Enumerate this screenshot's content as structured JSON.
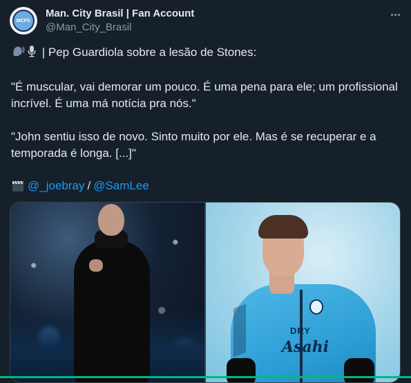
{
  "author": {
    "display_name": "Man. City Brasil | Fan Account",
    "handle": "@Man_City_Brasil",
    "avatar_icon": "man-city-crest-icon",
    "avatar_text": "MCFC"
  },
  "tweet": {
    "line1": "| Pep Guardiola sobre a lesão de Stones:",
    "line1_icons": [
      "speaking-head-icon",
      "microphone-icon"
    ],
    "quote1": "\"É muscular, vai demorar um pouco. É uma pena para ele; um profissional incrível. É uma má notícia pra nós.\"",
    "quote2": "\"John sentiu isso de novo. Sinto muito por ele. Mas é se recuperar e a temporada é longa. [...]\"",
    "credits_icon": "clapper-board-icon",
    "mention1": "@_joebray",
    "separator": "/",
    "mention2": "@SamLee"
  },
  "media": {
    "photo_sponsor_text": "Asahi",
    "photo_shirt_text": "DRY"
  },
  "colors": {
    "background": "#15202b",
    "text": "#e7e9ea",
    "secondary": "#8b98a5",
    "link": "#1d9bf0"
  }
}
